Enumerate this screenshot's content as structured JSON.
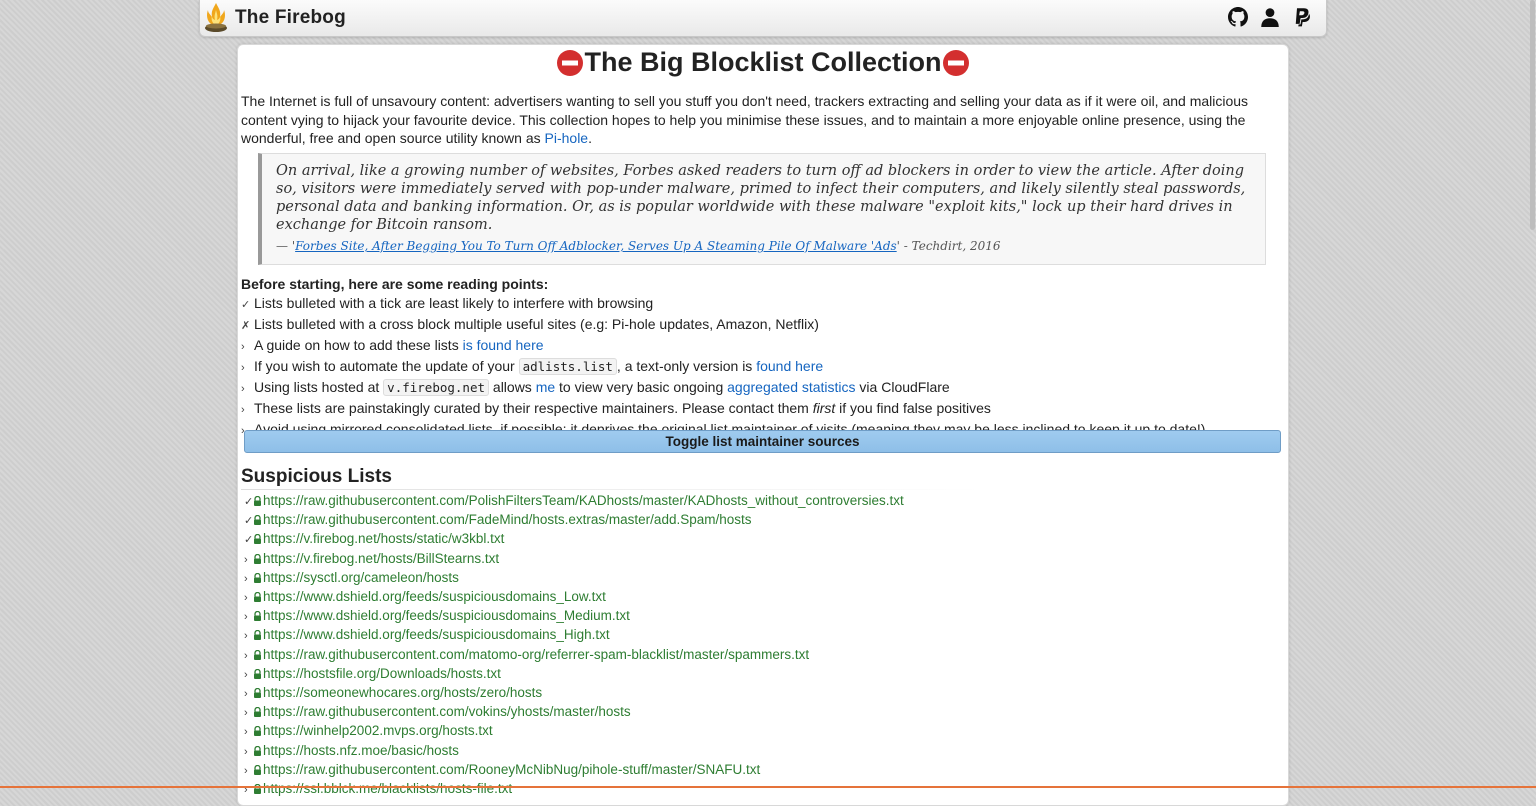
{
  "brand": {
    "name": "The Firebog"
  },
  "nav_icons": [
    "github-icon",
    "user-icon",
    "paypal-icon"
  ],
  "title": "The Big Blocklist Collection",
  "intro": {
    "text": "The Internet is full of unsavoury content: advertisers wanting to sell you stuff you don't need, trackers extracting and selling your data as if it were oil, and malicious content vying to hijack your favourite device. This collection hopes to help you minimise these issues, and to maintain a more enjoyable online presence, using the wonderful, free and open source utility known as ",
    "link": "Pi-hole",
    "end": "."
  },
  "quote": {
    "text": "On arrival, like a growing number of websites, Forbes asked readers to turn off ad blockers in order to view the article. After doing so, visitors were immediately served with pop-under malware, primed to infect their computers, and likely silently steal passwords, personal data and banking information. Or, as is popular worldwide with these malware \"exploit kits,\" lock up their hard drives in exchange for Bitcoin ransom.",
    "cite_prefix": "— '",
    "cite_link": "Forbes Site, After Begging You To Turn Off Adblocker, Serves Up A Steaming Pile Of Malware 'Ads",
    "cite_suffix": "' - Techdirt, 2016"
  },
  "points": {
    "heading": "Before starting, here are some reading points:",
    "tick": "Lists bulleted with a tick are least likely to interfere with browsing",
    "cross": "Lists bulleted with a cross block multiple useful sites (e.g: Pi-hole updates, Amazon, Netflix)",
    "guide_a": "A guide on how to add these lists ",
    "guide_link": "is found here",
    "auto_a": "If you wish to automate the update of your ",
    "auto_code": "adlists.list",
    "auto_b": ", a text-only version is ",
    "auto_link": "found here",
    "host_a": "Using lists hosted at ",
    "host_code": "v.firebog.net",
    "host_b": " allows ",
    "host_link1": "me",
    "host_c": " to view very basic ongoing ",
    "host_link2": "aggregated statistics",
    "host_d": " via CloudFlare",
    "curated_a": "These lists are painstakingly curated by their respective maintainers. Please contact them ",
    "curated_em": "first",
    "curated_b": " if you find false positives",
    "mirror": "Avoid using mirrored consolidated lists, if possible; it deprives the original list maintainer of visits (meaning they may be less inclined to keep it up to date!)"
  },
  "toggle_label": "Toggle list maintainer sources",
  "section_title": "Suspicious Lists",
  "lists": [
    {
      "bullet": "✓",
      "url": "https://raw.githubusercontent.com/PolishFiltersTeam/KADhosts/master/KADhosts_without_controversies.txt"
    },
    {
      "bullet": "✓",
      "url": "https://raw.githubusercontent.com/FadeMind/hosts.extras/master/add.Spam/hosts"
    },
    {
      "bullet": "✓",
      "url": "https://v.firebog.net/hosts/static/w3kbl.txt"
    },
    {
      "bullet": "›",
      "url": "https://v.firebog.net/hosts/BillStearns.txt"
    },
    {
      "bullet": "›",
      "url": "https://sysctl.org/cameleon/hosts"
    },
    {
      "bullet": "›",
      "url": "https://www.dshield.org/feeds/suspiciousdomains_Low.txt"
    },
    {
      "bullet": "›",
      "url": "https://www.dshield.org/feeds/suspiciousdomains_Medium.txt"
    },
    {
      "bullet": "›",
      "url": "https://www.dshield.org/feeds/suspiciousdomains_High.txt"
    },
    {
      "bullet": "›",
      "url": "https://raw.githubusercontent.com/matomo-org/referrer-spam-blacklist/master/spammers.txt"
    },
    {
      "bullet": "›",
      "url": "https://hostsfile.org/Downloads/hosts.txt"
    },
    {
      "bullet": "›",
      "url": "https://someonewhocares.org/hosts/zero/hosts"
    },
    {
      "bullet": "›",
      "url": "https://raw.githubusercontent.com/vokins/yhosts/master/hosts"
    },
    {
      "bullet": "›",
      "url": "https://winhelp2002.mvps.org/hosts.txt"
    },
    {
      "bullet": "›",
      "url": "https://hosts.nfz.moe/basic/hosts"
    },
    {
      "bullet": "›",
      "url": "https://raw.githubusercontent.com/RooneyMcNibNug/pihole-stuff/master/SNAFU.txt"
    },
    {
      "bullet": "›",
      "url": "https://ssl.bblck.me/blacklists/hosts-file.txt"
    }
  ],
  "colors": {
    "link": "#1565c0",
    "list_link": "#2e7d32",
    "toggle": "#8ebfe8",
    "noentry": "#d32f2f"
  }
}
